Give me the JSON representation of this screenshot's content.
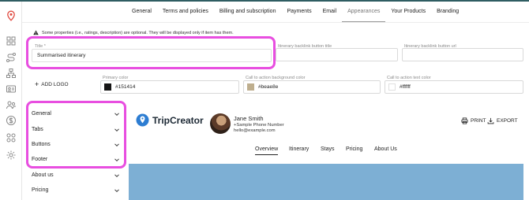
{
  "tabs": [
    {
      "label": "General",
      "active": false
    },
    {
      "label": "Terms and policies",
      "active": false
    },
    {
      "label": "Billing and subscription",
      "active": false
    },
    {
      "label": "Payments",
      "active": false
    },
    {
      "label": "Email",
      "active": false
    },
    {
      "label": "Appearances",
      "active": true
    },
    {
      "label": "Your Products",
      "active": false
    },
    {
      "label": "Branding",
      "active": false
    }
  ],
  "rail_icons": [
    "location-pin-icon",
    "grid-icon",
    "route-icon",
    "sitemap-icon",
    "id-card-icon",
    "people-icon",
    "dollar-icon",
    "apps-icon",
    "gear-icon"
  ],
  "notice": "Some properties (i.e., ratings, description) are optional. They will be displayed only if item has them.",
  "form": {
    "title_label": "Title *",
    "title_value": "Summarised itinerary",
    "backlink_title_label": "Itinerary backlink button title",
    "backlink_title_value": "",
    "backlink_url_label": "Itinerary backlink button url",
    "backlink_url_value": "",
    "add_logo": "ADD LOGO",
    "primary_color_label": "Primary color",
    "primary_color_value": "#151414",
    "cta_bg_label": "Call to action background color",
    "cta_bg_value": "#beae8e",
    "cta_text_label": "Call to action text color",
    "cta_text_value": "#ffffff"
  },
  "accordion": [
    {
      "label": "General"
    },
    {
      "label": "Tabs"
    },
    {
      "label": "Buttons"
    },
    {
      "label": "Footer"
    },
    {
      "label": "About us"
    },
    {
      "label": "Pricing"
    }
  ],
  "preview": {
    "logo_text": "TripCreator",
    "contact_name": "Jane Smith",
    "contact_phone": "+Sample Phone Number",
    "contact_email": "hello@example.com",
    "print_label": "PRINT",
    "export_label": "EXPORT",
    "nav": [
      "Overview",
      "Itinerary",
      "Stays",
      "Pricing",
      "About Us"
    ],
    "nav_active": "Overview"
  },
  "colors": {
    "accent_pink": "#e84ee0",
    "primary_swatch": "#151414",
    "cta_bg_swatch": "#beae8e",
    "cta_text_swatch": "#ffffff",
    "hero": "#7dafd4",
    "logo_blue": "#2d7dd2",
    "pin_red": "#e0483e"
  }
}
